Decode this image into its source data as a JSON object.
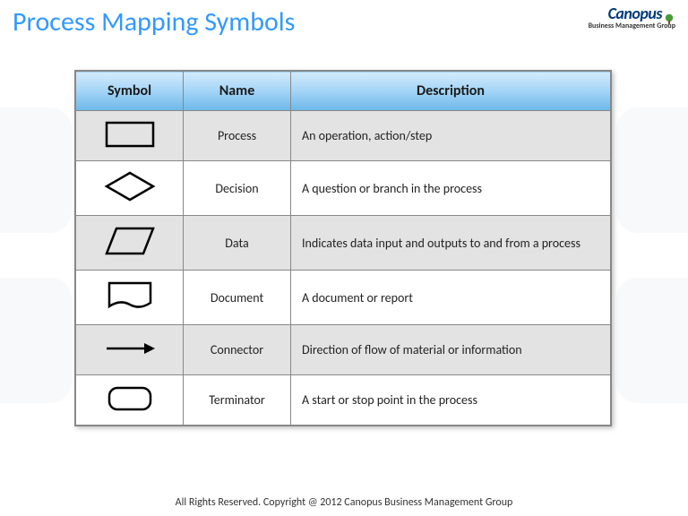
{
  "title": "Process Mapping Symbols",
  "logo": {
    "main": "Canopus",
    "sub": "Business Management Group"
  },
  "headers": {
    "symbol": "Symbol",
    "name": "Name",
    "description": "Description"
  },
  "rows": [
    {
      "icon": "process",
      "name": "Process",
      "description": "An operation, action/step"
    },
    {
      "icon": "decision",
      "name": "Decision",
      "description": "A question or branch in the process"
    },
    {
      "icon": "data",
      "name": "Data",
      "description": "Indicates data input and outputs to and from a process"
    },
    {
      "icon": "document",
      "name": "Document",
      "description": "A document or report"
    },
    {
      "icon": "connector",
      "name": "Connector",
      "description": "Direction of flow of material or information"
    },
    {
      "icon": "terminator",
      "name": "Terminator",
      "description": "A start or stop point in the process"
    }
  ],
  "footer": "All Rights Reserved. Copyright @ 2012 Canopus Business Management Group"
}
